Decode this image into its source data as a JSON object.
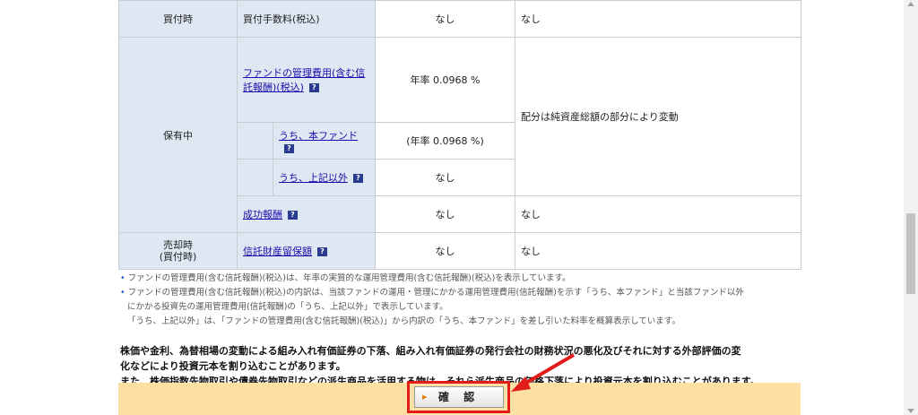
{
  "table": {
    "buy_label": "買付時",
    "buy_fee_label": "買付手数料(税込)",
    "buy_fee_value": "なし",
    "buy_fee_note": "なし",
    "hold_label": "保有中",
    "mgmt_fee_link": "ファンドの管理費用(含む信託報酬)(税込)",
    "mgmt_fee_value": "年率 0.0968 %",
    "mgmt_fee_note": "配分は純資産総額の部分により変動",
    "this_fund_link": "うち、本ファンド",
    "this_fund_value": "(年率 0.0968 %)",
    "other_link": "うち、上記以外",
    "other_value": "なし",
    "success_fee_link": "成功報酬",
    "success_fee_value": "なし",
    "success_fee_note": "なし",
    "sell_label": "売却時\n(買付時)",
    "trust_reserve_link": "信託財産留保額",
    "trust_reserve_value": "なし",
    "trust_reserve_note": "なし"
  },
  "notes": [
    "ファンドの管理費用(含む信託報酬)(税込)は、年率の実質的な運用管理費用(含む信託報酬)(税込)を表示しています。",
    "ファンドの管理費用(含む信託報酬)(税込)の内訳は、当該ファンドの運用・管理にかかる運用管理費用(信託報酬)を示す「うち、本ファンド」と当該ファンド以外",
    "にかかる投資先の運用管理費用(信託報酬)の「うち、上記以外」で表示しています。",
    "「うち、上記以外」は、「ファンドの管理費用(含む信託報酬)(税込)」から内訳の「うち、本ファンド」を差し引いた料率を概算表示しています。"
  ],
  "warning": [
    "株価や金利、為替相場の変動による組み入れ有価証券の下落、組み入れ有価証券の発行会社の財務状況の悪化及びそれに対する外部評価の変",
    "化などにより投資元本を割り込むことがあります。",
    "また、株価指数先物取引や債券先物取引などの派生商品を活用する物は、それら派生商品の価格下落により投資元本を割り込むことがあります。"
  ],
  "confirm_button": "確 認",
  "help_icon": "question-icon",
  "colors": {
    "label_bg": "#dde8f2",
    "button_bar": "#fde0a4",
    "highlight": "#e21b1b",
    "link": "#1a0dab"
  }
}
